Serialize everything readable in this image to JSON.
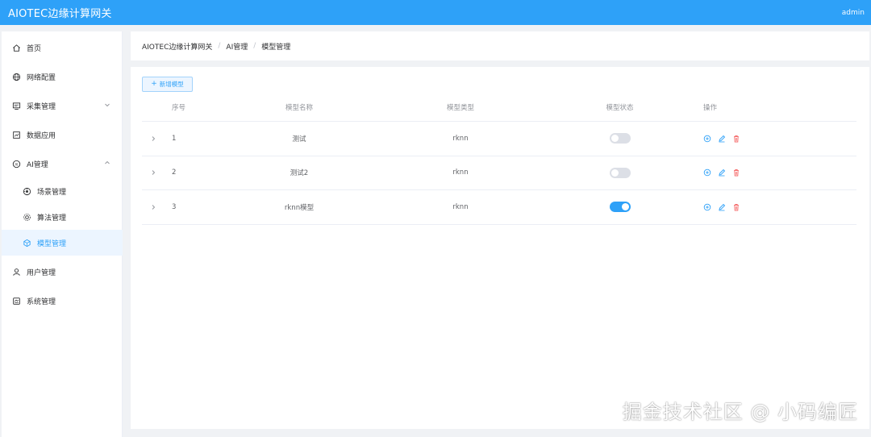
{
  "header": {
    "title": "AIOTEC边缘计算网关",
    "user": "admin"
  },
  "colors": {
    "accent": "#2ea1f8",
    "active_bg": "#ecf5ff",
    "danger": "#f56c6c"
  },
  "sidebar": {
    "items": [
      {
        "label": "首页",
        "icon": "home-icon"
      },
      {
        "label": "网络配置",
        "icon": "globe-icon"
      },
      {
        "label": "采集管理",
        "icon": "monitor-icon",
        "expandable": true,
        "expanded": false
      },
      {
        "label": "数据应用",
        "icon": "data-app-icon"
      },
      {
        "label": "AI管理",
        "icon": "ai-icon",
        "expandable": true,
        "expanded": true
      },
      {
        "label": "场景管理",
        "icon": "scene-icon",
        "sub": true
      },
      {
        "label": "算法管理",
        "icon": "algorithm-icon",
        "sub": true
      },
      {
        "label": "模型管理",
        "icon": "model-icon",
        "sub": true,
        "active": true
      },
      {
        "label": "用户管理",
        "icon": "user-icon"
      },
      {
        "label": "系统管理",
        "icon": "system-icon"
      }
    ]
  },
  "breadcrumb": [
    "AIOTEC边缘计算网关",
    "AI管理",
    "模型管理"
  ],
  "breadcrumb_separator": "/",
  "toolbar": {
    "add_label": "新增模型",
    "add_icon": "plus-icon"
  },
  "table": {
    "columns": [
      "序号",
      "模型名称",
      "模型类型",
      "模型状态",
      "操作"
    ],
    "rows": [
      {
        "no": "1",
        "name": "测试",
        "type": "rknn",
        "status": false
      },
      {
        "no": "2",
        "name": "测试2",
        "type": "rknn",
        "status": false
      },
      {
        "no": "3",
        "name": "rknn模型",
        "type": "rknn",
        "status": true
      }
    ],
    "row_actions": [
      "detail-icon",
      "edit-icon",
      "delete-icon"
    ]
  },
  "watermark": "掘金技术社区 @ 小码编匠"
}
